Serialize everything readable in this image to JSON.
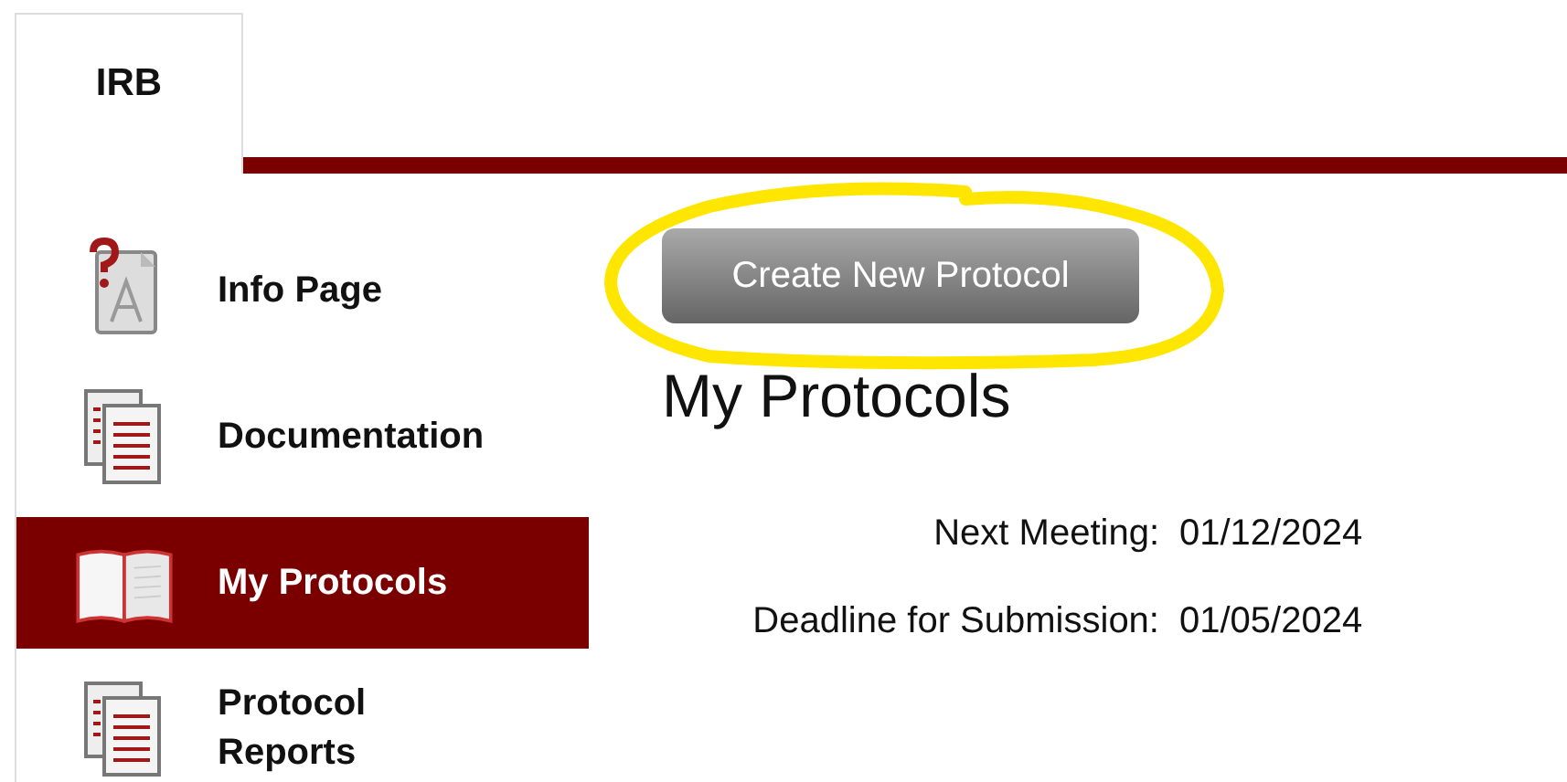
{
  "tabs": [
    {
      "label": "IRB",
      "selected": true
    }
  ],
  "sidebar": {
    "items": [
      {
        "label": "Info Page",
        "kind": "info",
        "selected": false
      },
      {
        "label": "Documentation",
        "kind": "documents",
        "selected": false
      },
      {
        "label": "My Protocols",
        "kind": "book",
        "selected": true
      },
      {
        "label": "Protocol Reports",
        "kind": "documents",
        "selected": false
      }
    ]
  },
  "create_button": "Create New Protocol",
  "heading": "My Protocols",
  "details": [
    {
      "label": "Next Meeting:",
      "value": "01/12/2024"
    },
    {
      "label": "Deadline for Submission:",
      "value": "01/05/2024"
    }
  ]
}
